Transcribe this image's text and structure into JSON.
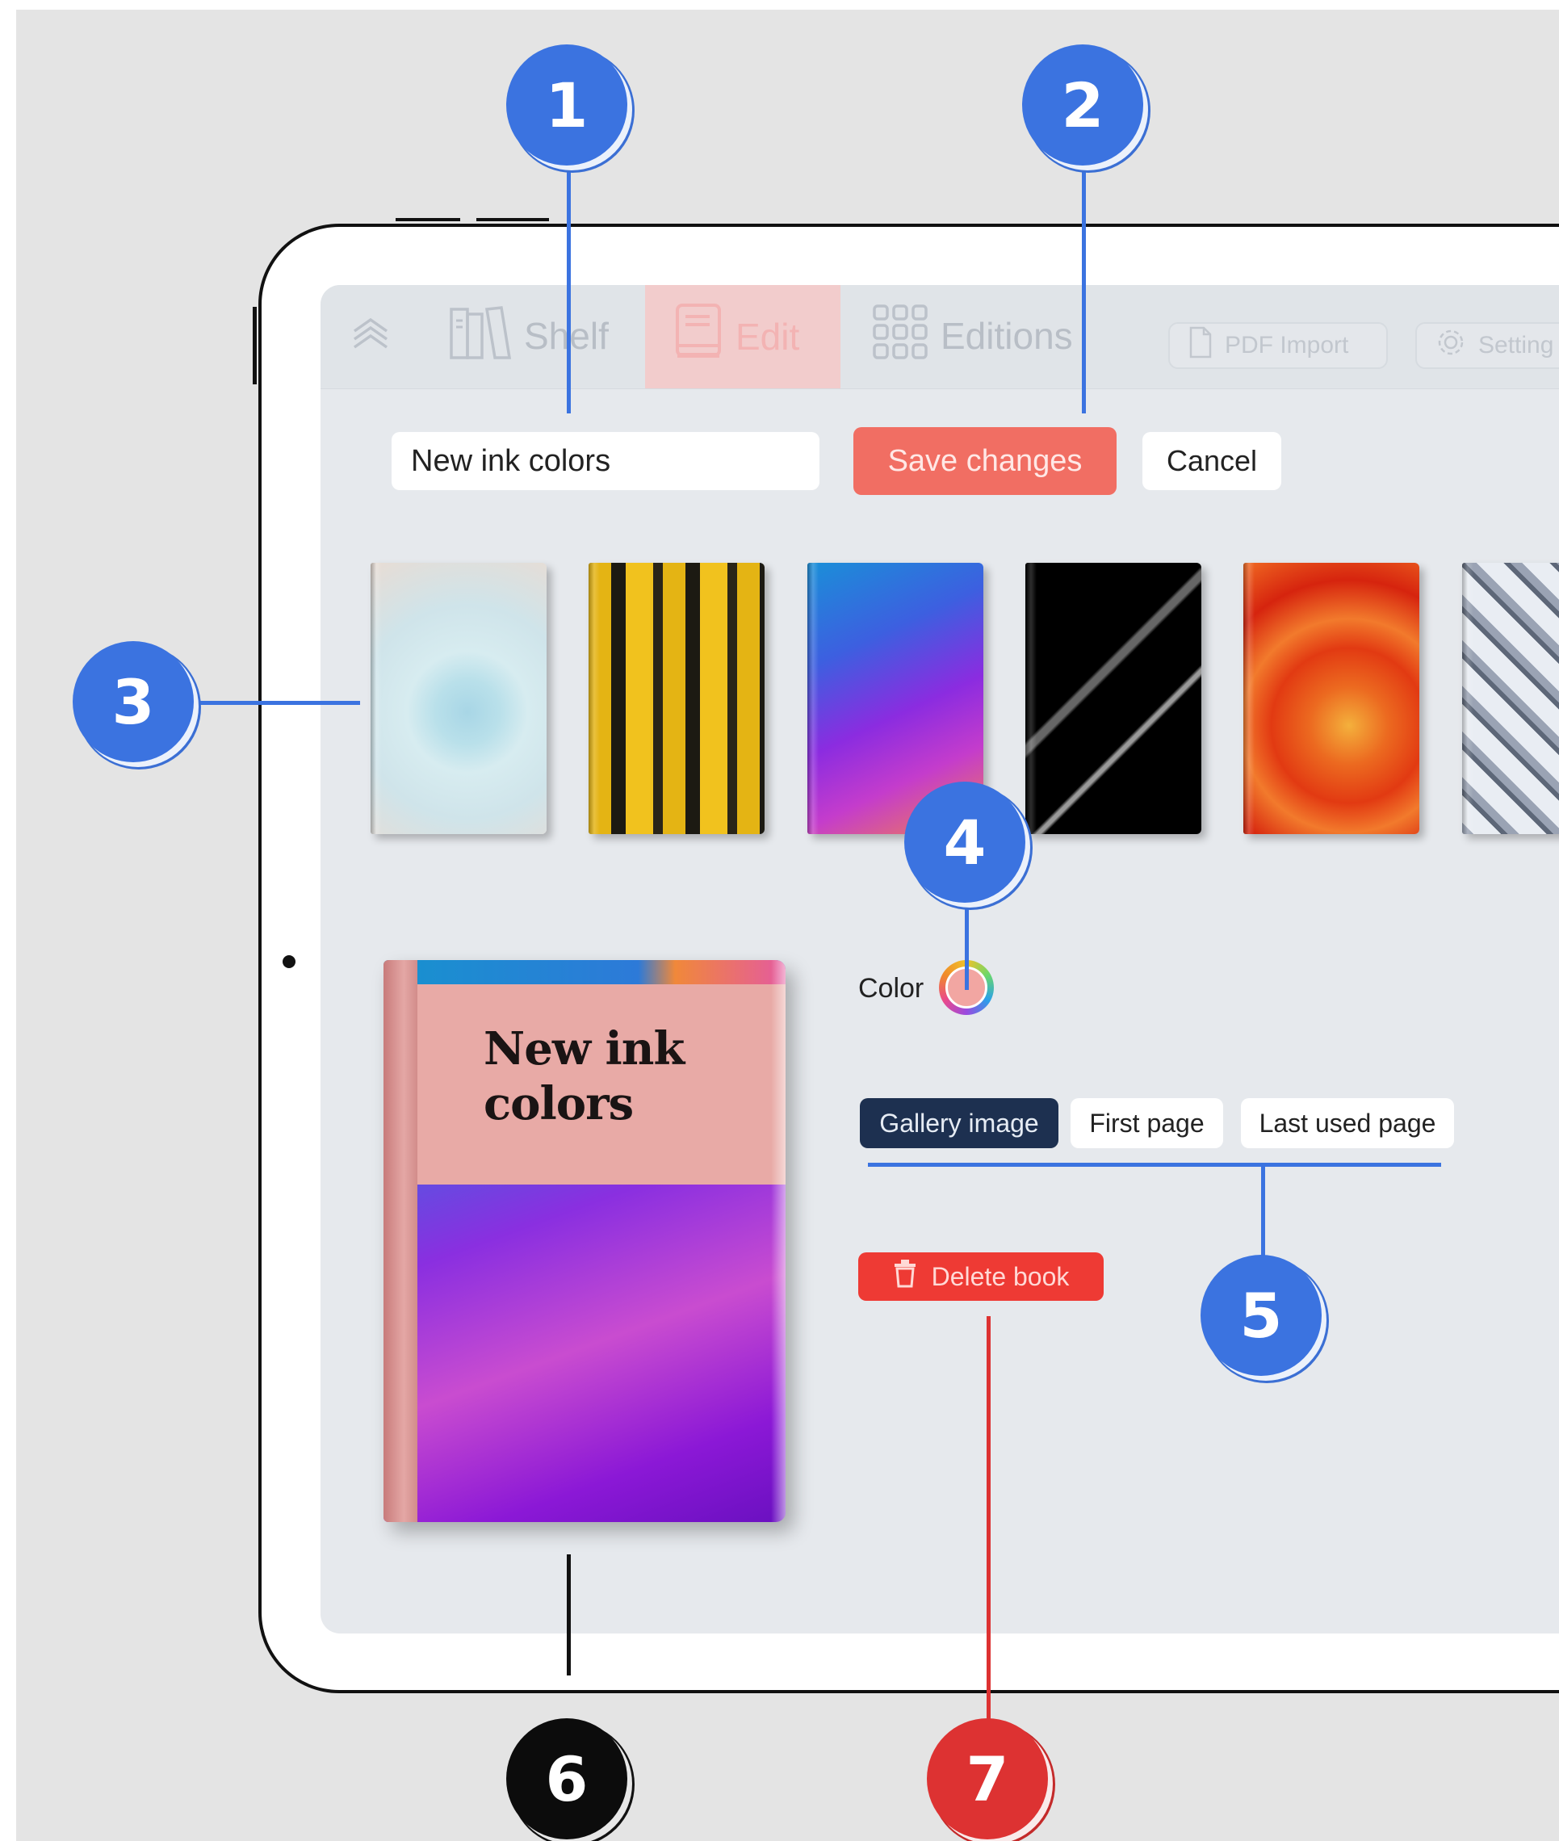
{
  "nav": {
    "menu_icon": "chevrons-up-icon",
    "items": [
      {
        "label": "Shelf",
        "icon": "bookshelf-icon",
        "active": false
      },
      {
        "label": "Edit",
        "icon": "book-edit-icon",
        "active": true
      },
      {
        "label": "Editions",
        "icon": "grid-icon",
        "active": false
      }
    ],
    "pdf_import": {
      "label": "PDF Import",
      "icon": "document-icon"
    },
    "settings": {
      "label": "Setting",
      "icon": "gear-icon"
    }
  },
  "editor": {
    "title_value": "New ink colors",
    "save_label": "Save changes",
    "cancel_label": "Cancel"
  },
  "gallery": {
    "covers": [
      "cover-pastel-3d",
      "cover-yellow-typography",
      "cover-gradient-wave",
      "cover-black-lines",
      "cover-orange-swirl",
      "cover-white-lattice"
    ]
  },
  "preview": {
    "book_title_line1": "New ink",
    "book_title_line2": "colors"
  },
  "options": {
    "color_label": "Color",
    "color_value": "#f2a6a2",
    "source_tabs": [
      "Gallery image",
      "First page",
      "Last used page"
    ],
    "selected_source": "Gallery image",
    "delete_label": "Delete book"
  },
  "annotations": {
    "markers": [
      "1",
      "2",
      "3",
      "4",
      "5",
      "6",
      "7"
    ]
  },
  "colors": {
    "accent_blue": "#3b73e0",
    "save_red": "#f16e63",
    "delete_red": "#ee3a34",
    "selected_tab": "#1d3050"
  }
}
